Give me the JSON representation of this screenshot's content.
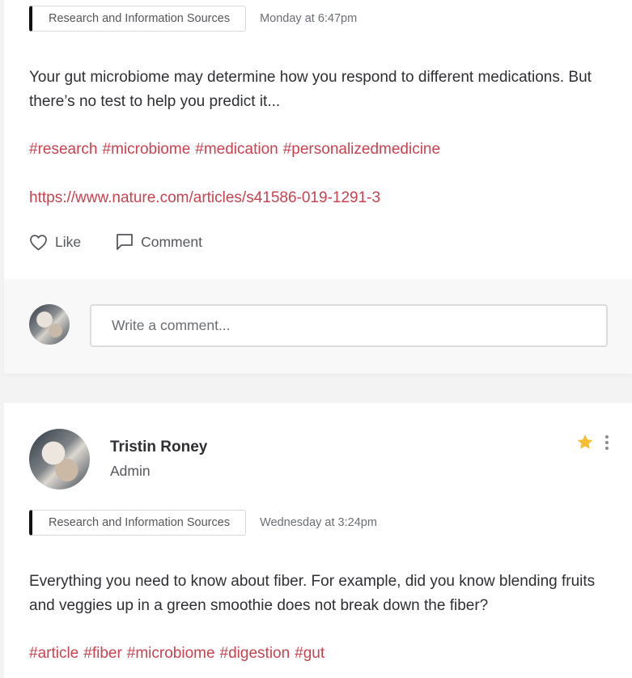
{
  "post1": {
    "category": "Research and Information Sources",
    "time": "Monday at 6:47pm",
    "body": "Your gut microbiome may determine how you respond to different medications. But there’s no test to help you predict it...",
    "hashtags": [
      "#research",
      "#microbiome",
      "#medication",
      "#personalizedmedicine"
    ],
    "link": "https://www.nature.com/articles/s41586-019-1291-3",
    "like_label": "Like",
    "comment_label": "Comment",
    "comment_placeholder": "Write a comment..."
  },
  "post2": {
    "author_name": "Tristin Roney",
    "author_role": "Admin",
    "category": "Research and Information Sources",
    "time": "Wednesday at 3:24pm",
    "body": "Everything you need to know about fiber. For example, did you know blending fruits and veggies up in a green smoothie does not break down the fiber?",
    "hashtags": [
      "#article",
      "#fiber",
      "#microbiome",
      "#digestion",
      "#gut"
    ]
  },
  "colors": {
    "accent": "#c8434f",
    "star": "#f5bd2f",
    "tag_border": "#111111"
  },
  "icons": [
    "heart-icon",
    "comment-icon",
    "star-icon",
    "more-vertical-icon"
  ]
}
